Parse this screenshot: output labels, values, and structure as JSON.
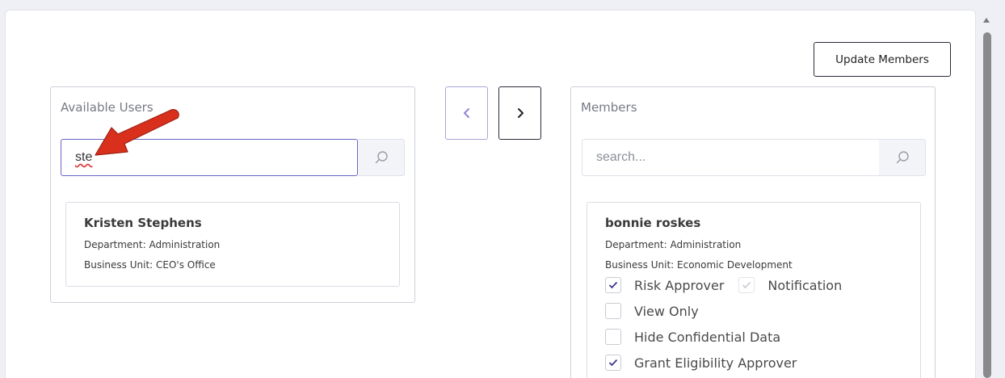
{
  "header": {
    "update_label": "Update Members"
  },
  "available": {
    "title": "Available Users",
    "search_value": "ste",
    "users": [
      {
        "name": "Kristen Stephens",
        "department": "Department: Administration",
        "business_unit": "Business Unit: CEO's Office"
      }
    ]
  },
  "members": {
    "title": "Members",
    "search_placeholder": "search...",
    "users": [
      {
        "name": "bonnie roskes",
        "department": "Department: Administration",
        "business_unit": "Business Unit: Economic Development",
        "roles": {
          "risk_approver": {
            "label": "Risk Approver",
            "checked": true
          },
          "notification": {
            "label": "Notification",
            "checked": true,
            "disabled": true
          },
          "view_only": {
            "label": "View Only",
            "checked": false
          },
          "hide_confidential": {
            "label": "Hide Confidential Data",
            "checked": false
          },
          "grant_eligibility": {
            "label": "Grant Eligibility Approver",
            "checked": true
          }
        }
      }
    ]
  },
  "colors": {
    "accent": "#6b66c6",
    "annotation_arrow": "#d9301e"
  }
}
